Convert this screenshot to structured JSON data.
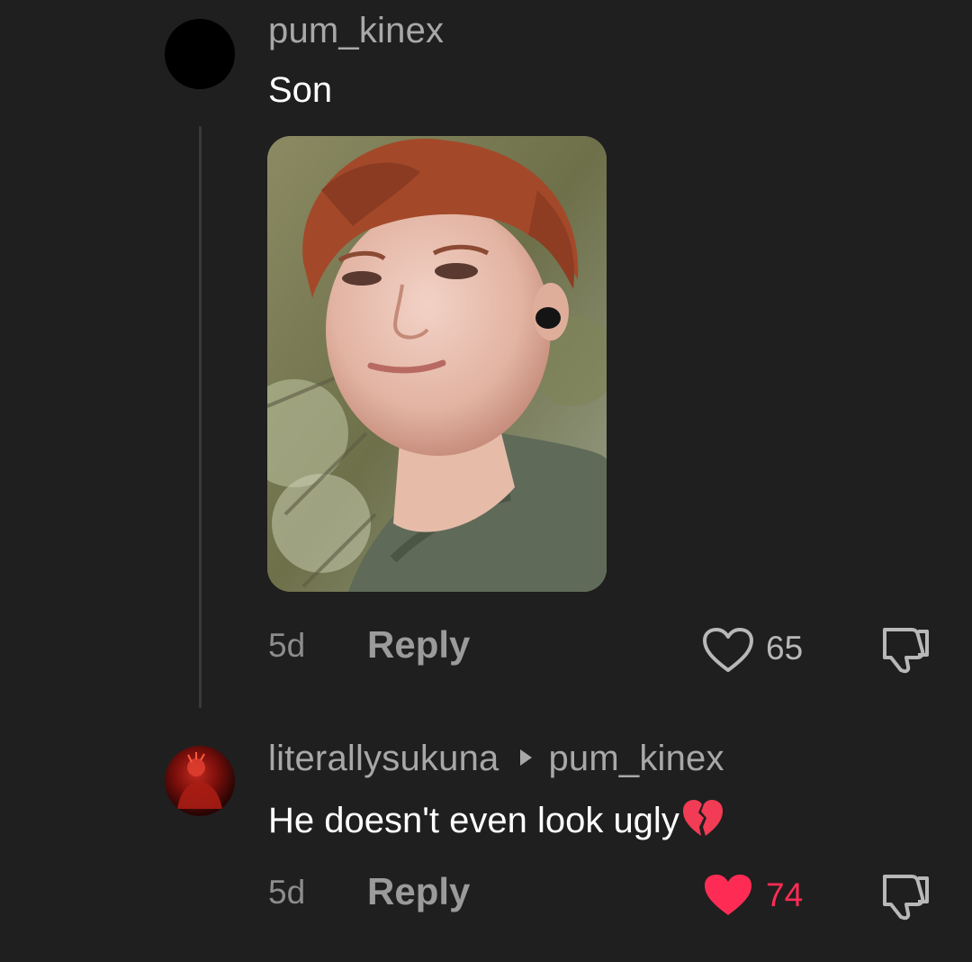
{
  "comments": [
    {
      "username": "pum_kinex",
      "text": "Son",
      "has_photo": true,
      "timestamp": "5d",
      "reply_label": "Reply",
      "likes": "65",
      "liked": false
    },
    {
      "username": "literallysukuna",
      "reply_to": "pum_kinex",
      "text": "He doesn't even look ugly",
      "emoji": "broken-heart",
      "timestamp": "5d",
      "reply_label": "Reply",
      "likes": "74",
      "liked": true
    }
  ],
  "colors": {
    "background": "#1f1f1f",
    "username": "#a8a8a8",
    "like_active": "#fe2c55",
    "muted": "#8d8d8d"
  },
  "icons": {
    "like": "heart-outline-icon",
    "like_active": "heart-filled-icon",
    "dislike": "thumbs-down-icon",
    "reply_arrow": "caret-right-icon"
  }
}
